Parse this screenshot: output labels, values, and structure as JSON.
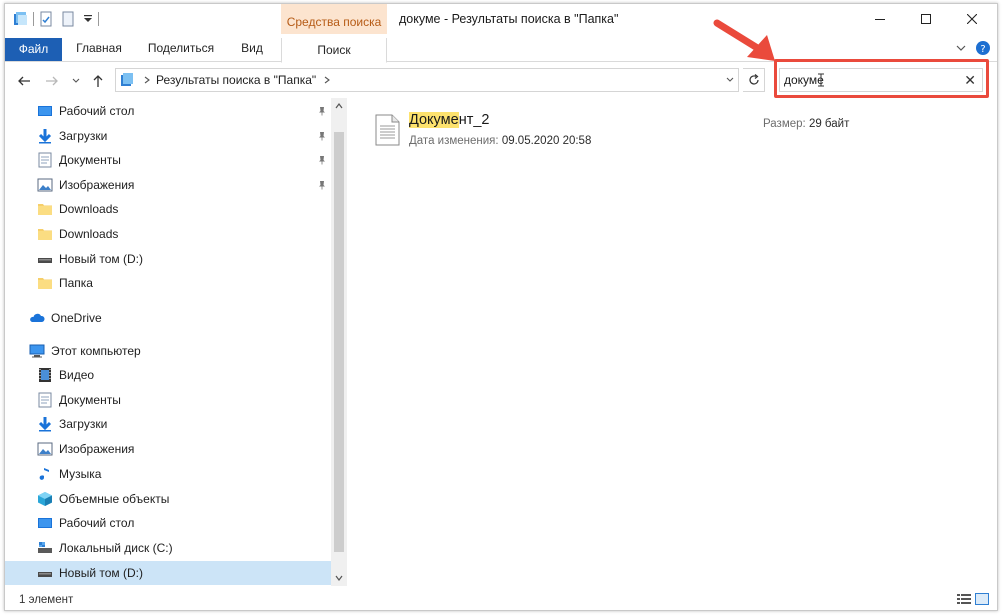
{
  "window": {
    "title": "докуме - Результаты поиска в \"Папка\""
  },
  "ribbon": {
    "context_group": "Средства поиска",
    "tabs": [
      {
        "label": "Файл"
      },
      {
        "label": "Главная"
      },
      {
        "label": "Поделиться"
      },
      {
        "label": "Вид"
      },
      {
        "label": "Поиск"
      }
    ]
  },
  "address": {
    "breadcrumb": "Результаты поиска в \"Папка\""
  },
  "search": {
    "value": "докуме"
  },
  "sidebar": {
    "quick_access": [
      {
        "label": "Рабочий стол",
        "icon": "desktop-icon",
        "pinned": true
      },
      {
        "label": "Загрузки",
        "icon": "download-arrow-icon",
        "pinned": true
      },
      {
        "label": "Документы",
        "icon": "documents-icon",
        "pinned": true
      },
      {
        "label": "Изображения",
        "icon": "pictures-icon",
        "pinned": true
      },
      {
        "label": "Downloads",
        "icon": "folder-icon",
        "pinned": false
      },
      {
        "label": "Downloads",
        "icon": "folder-icon",
        "pinned": false
      },
      {
        "label": "Новый том (D:)",
        "icon": "drive-icon",
        "pinned": false
      },
      {
        "label": "Папка",
        "icon": "folder-icon",
        "pinned": false
      }
    ],
    "onedrive": {
      "label": "OneDrive",
      "icon": "cloud-icon"
    },
    "this_pc": {
      "label": "Этот компьютер",
      "icon": "computer-icon"
    },
    "pc_items": [
      {
        "label": "Видео",
        "icon": "video-icon"
      },
      {
        "label": "Документы",
        "icon": "documents-icon"
      },
      {
        "label": "Загрузки",
        "icon": "download-arrow-icon"
      },
      {
        "label": "Изображения",
        "icon": "pictures-icon"
      },
      {
        "label": "Музыка",
        "icon": "music-note-icon"
      },
      {
        "label": "Объемные объекты",
        "icon": "3d-objects-icon"
      },
      {
        "label": "Рабочий стол",
        "icon": "desktop-icon"
      },
      {
        "label": "Локальный диск (C:)",
        "icon": "system-drive-icon"
      },
      {
        "label": "Новый том (D:)",
        "icon": "drive-icon",
        "selected": true
      }
    ]
  },
  "results": [
    {
      "name_match": "Докуме",
      "name_rest": "нт_2",
      "modified_label": "Дата изменения:",
      "modified_value": "09.05.2020 20:58",
      "size_label": "Размер:",
      "size_value": "29 байт"
    }
  ],
  "status": {
    "count": "1 элемент"
  },
  "colors": {
    "accent": "#1d5fb4",
    "context_tab_bg": "#fce4cf",
    "context_tab_text": "#b65b16",
    "highlight": "#fde26e",
    "annotation": "#ea4a3c",
    "selected_bg": "#cce4f7"
  }
}
